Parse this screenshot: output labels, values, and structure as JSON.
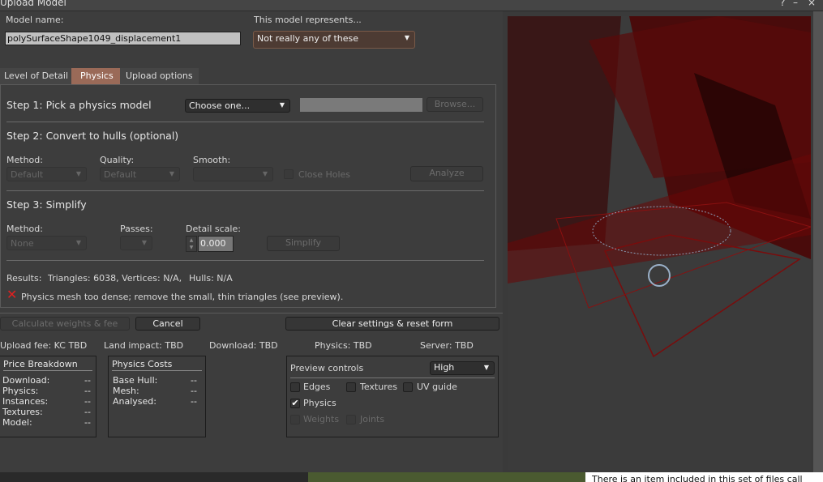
{
  "window": {
    "title": "Upload Model",
    "help": "?",
    "minimize": "–",
    "close": "×"
  },
  "model_name": {
    "label": "Model name:",
    "value": "polySurfaceShape1049_displacement1"
  },
  "represents": {
    "label": "This model represents...",
    "value": "Not really any of these"
  },
  "tabs": [
    {
      "label": "Level of Detail",
      "active": false
    },
    {
      "label": "Physics",
      "active": true
    },
    {
      "label": "Upload options",
      "active": false
    }
  ],
  "step1": {
    "title": "Step 1: Pick a physics model",
    "combo": "Choose one...",
    "file": "",
    "browse": "Browse..."
  },
  "step2": {
    "title": "Step 2: Convert to hulls (optional)",
    "method_label": "Method:",
    "method": "Default",
    "quality_label": "Quality:",
    "quality": "Default",
    "smooth_label": "Smooth:",
    "smooth": "",
    "close_holes": "Close Holes",
    "analyze": "Analyze"
  },
  "step3": {
    "title": "Step 3: Simplify",
    "method_label": "Method:",
    "method": "None",
    "passes_label": "Passes:",
    "passes": "",
    "detail_label": "Detail scale:",
    "detail": "0.000",
    "simplify": "Simplify"
  },
  "results": {
    "label": "Results:",
    "triangles": "Triangles: 6038, Vertices: N/A,",
    "hulls": "Hulls: N/A",
    "error": "Physics mesh too dense; remove the small, thin triangles (see preview)."
  },
  "buttons": {
    "calculate": "Calculate weights & fee",
    "cancel": "Cancel",
    "clear": "Clear settings & reset form"
  },
  "fees": {
    "upload": "Upload fee: KC TBD",
    "land": "Land impact: TBD",
    "download": "Download: TBD",
    "physics": "Physics: TBD",
    "server": "Server: TBD"
  },
  "price": {
    "title": "Price Breakdown",
    "rows": [
      [
        "Download:",
        "--"
      ],
      [
        "Physics:",
        "--"
      ],
      [
        "Instances:",
        "--"
      ],
      [
        "Textures:",
        "--"
      ],
      [
        "Model:",
        "--"
      ]
    ]
  },
  "physics_costs": {
    "title": "Physics Costs",
    "rows": [
      [
        "Base Hull:",
        "--"
      ],
      [
        "Mesh:",
        "--"
      ],
      [
        "Analysed:",
        "--"
      ]
    ]
  },
  "preview": {
    "title": "Preview controls",
    "level": "High",
    "edges": "Edges",
    "textures": "Textures",
    "uv": "UV guide",
    "physics": "Physics",
    "physics_checked": true,
    "weights": "Weights",
    "joints": "Joints"
  },
  "background_text": "There is an item included in this set of files call"
}
